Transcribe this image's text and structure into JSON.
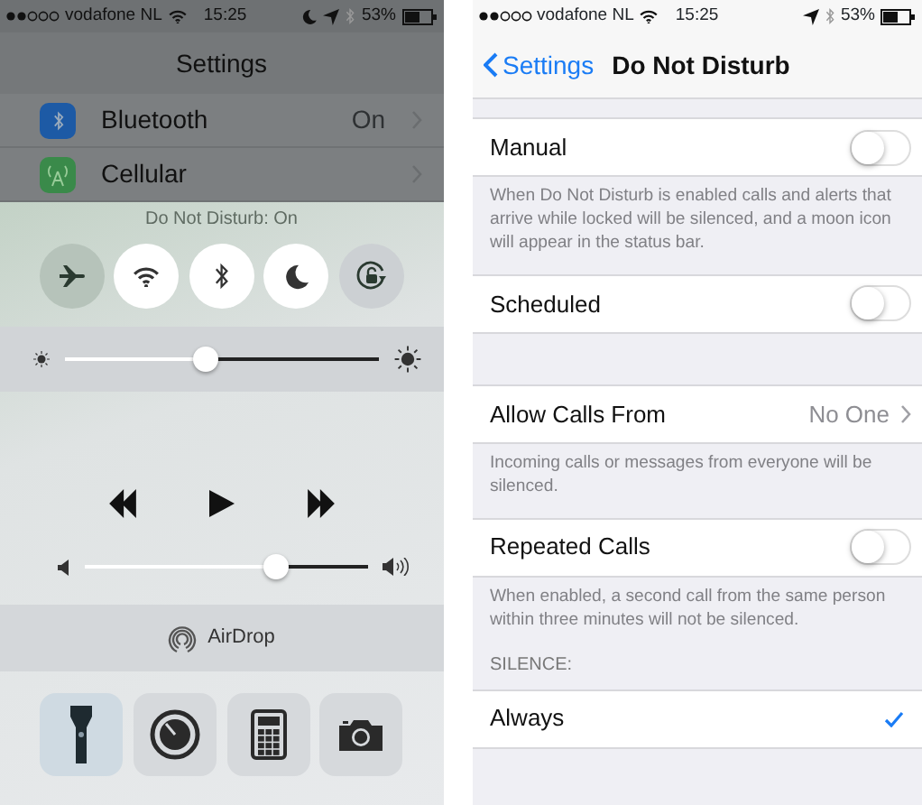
{
  "control_center_screen": {
    "status_bar": {
      "carrier": "vodafone NL",
      "time": "15:25",
      "battery": "53%"
    },
    "background_title": "Settings",
    "background_rows": [
      {
        "kind": "bluetooth",
        "label": "Bluetooth",
        "value": "On"
      },
      {
        "kind": "cellular",
        "label": "Cellular"
      }
    ],
    "notice": "Do Not Disturb: On",
    "toggles": [
      {
        "kind": "airplane",
        "on": false
      },
      {
        "kind": "wifi",
        "on": true
      },
      {
        "kind": "bluetooth",
        "on": true
      },
      {
        "kind": "moon",
        "on": true
      },
      {
        "kind": "rotation-lock",
        "on": false
      }
    ],
    "brightness": {
      "level": 0.45
    },
    "volume": {
      "level": 0.68
    },
    "airdrop": "AirDrop",
    "shortcuts": [
      {
        "kind": "flashlight"
      },
      {
        "kind": "timer"
      },
      {
        "kind": "calculator"
      },
      {
        "kind": "camera"
      }
    ]
  },
  "dnd_screen": {
    "status_bar": {
      "carrier": "vodafone NL",
      "time": "15:25",
      "battery": "53%"
    },
    "back": "Settings",
    "title": "Do Not Disturb",
    "groups": [
      {
        "rows": [
          {
            "kind": "switch",
            "label": "Manual",
            "on": false
          }
        ],
        "footer": "When Do Not Disturb is enabled calls and alerts that arrive while locked will be silenced, and a moon icon will appear in the status bar."
      },
      {
        "rows": [
          {
            "kind": "switch",
            "label": "Scheduled",
            "on": false
          }
        ]
      },
      {
        "rows": [
          {
            "kind": "value",
            "label": "Allow Calls From",
            "value": "No One"
          }
        ],
        "footer": "Incoming calls or messages from everyone will be silenced."
      },
      {
        "rows": [
          {
            "kind": "switch",
            "label": "Repeated Calls",
            "on": false
          }
        ],
        "footer": "When enabled, a second call from the same person within three minutes will not be silenced."
      },
      {
        "header": "SILENCE:",
        "rows": [
          {
            "kind": "check",
            "label": "Always",
            "selected": true
          }
        ]
      }
    ]
  }
}
